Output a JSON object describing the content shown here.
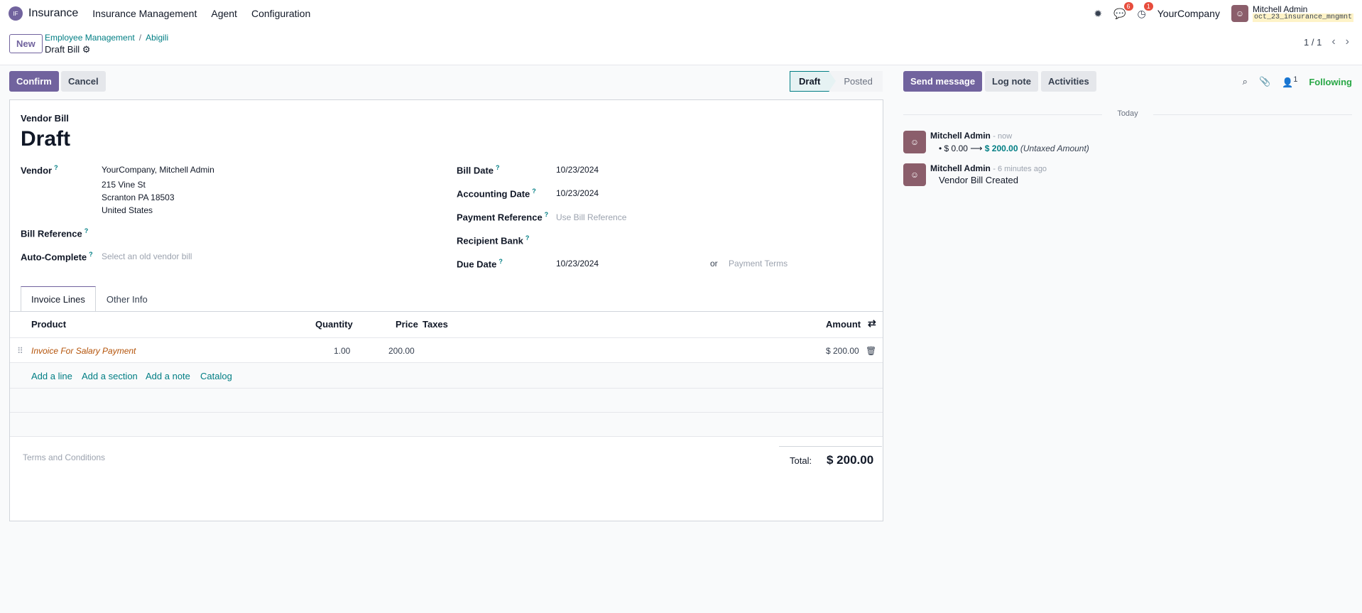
{
  "topbar": {
    "app_name": "Insurance",
    "menu": [
      "Insurance Management",
      "Agent",
      "Configuration"
    ],
    "messages_badge": "6",
    "activities_badge": "1",
    "company": "YourCompany",
    "user_name": "Mitchell Admin",
    "db_name": "oct_23_insurance_mngmnt"
  },
  "control": {
    "new_label": "New",
    "breadcrumb": [
      "Employee Management",
      "Abigili"
    ],
    "record_name": "Draft Bill",
    "pager": "1 / 1"
  },
  "actions": {
    "confirm": "Confirm",
    "cancel": "Cancel",
    "status_draft": "Draft",
    "status_posted": "Posted"
  },
  "chatter_actions": {
    "send_message": "Send message",
    "log_note": "Log note",
    "activities": "Activities",
    "followers_count": "1",
    "following": "Following"
  },
  "form": {
    "doc_type": "Vendor Bill",
    "title": "Draft",
    "vendor_label": "Vendor",
    "vendor_lines": [
      "YourCompany, Mitchell Admin",
      "215 Vine St",
      "Scranton PA 18503",
      "United States"
    ],
    "bill_reference_label": "Bill Reference",
    "auto_complete_label": "Auto-Complete",
    "auto_complete_placeholder": "Select an old vendor bill",
    "bill_date_label": "Bill Date",
    "bill_date": "10/23/2024",
    "accounting_date_label": "Accounting Date",
    "accounting_date": "10/23/2024",
    "payment_reference_label": "Payment Reference",
    "payment_reference_placeholder": "Use Bill Reference",
    "recipient_bank_label": "Recipient Bank",
    "due_date_label": "Due Date",
    "due_date": "10/23/2024",
    "or": "or",
    "payment_terms_placeholder": "Payment Terms",
    "tooltip_mark": "?"
  },
  "tabs": [
    "Invoice Lines",
    "Other Info"
  ],
  "lines": {
    "headers": {
      "product": "Product",
      "quantity": "Quantity",
      "price": "Price",
      "taxes": "Taxes",
      "amount": "Amount"
    },
    "rows": [
      {
        "product": "Invoice For Salary Payment",
        "quantity": "1.00",
        "price": "200.00",
        "taxes": "",
        "amount": "$ 200.00"
      }
    ],
    "add_line": "Add a line",
    "add_section": "Add a section",
    "add_note": "Add a note",
    "catalog": "Catalog"
  },
  "footer": {
    "terms_placeholder": "Terms and Conditions",
    "total_label": "Total:",
    "total_value": "$ 200.00"
  },
  "chatter": {
    "date_separator": "Today",
    "messages": [
      {
        "author": "Mitchell Admin",
        "time": "- now",
        "old_value": "$ 0.00",
        "new_value": "$ 200.00",
        "field": "(Untaxed Amount)"
      },
      {
        "author": "Mitchell Admin",
        "time": "- 6 minutes ago",
        "body": "Vendor Bill Created"
      }
    ]
  }
}
